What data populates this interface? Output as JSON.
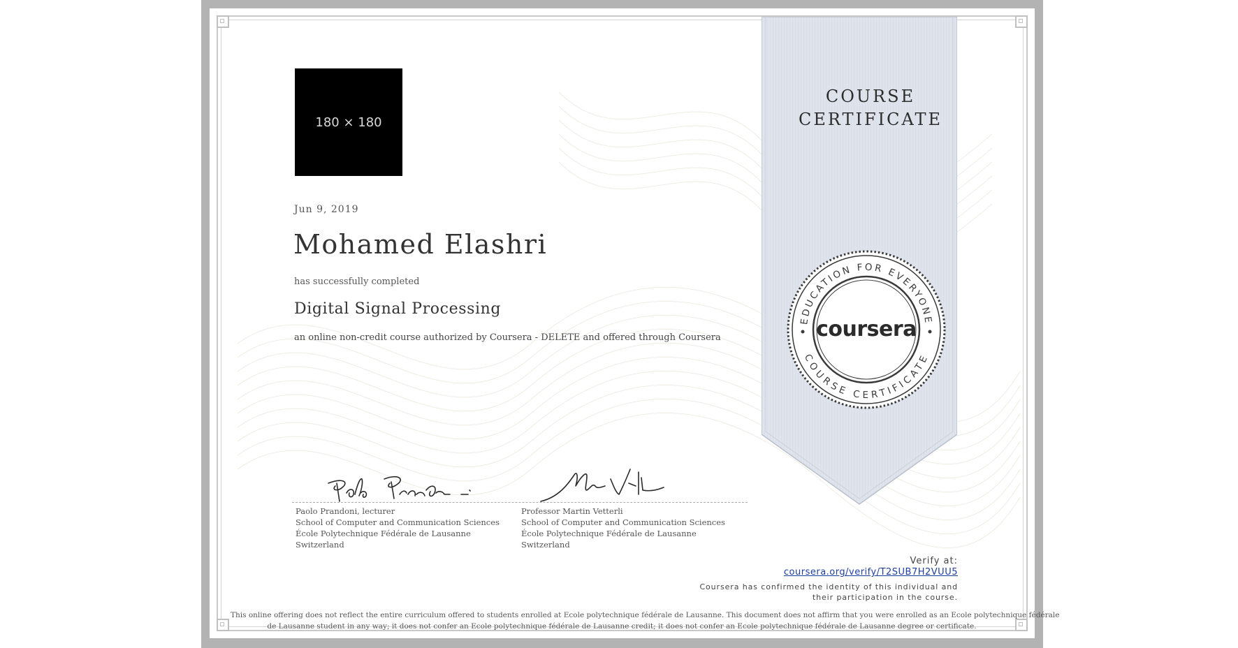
{
  "certificate": {
    "logo_placeholder": "180 × 180",
    "date": "Jun 9, 2019",
    "recipient_name": "Mohamed Elashri",
    "completed_text": "has successfully completed",
    "course_title": "Digital Signal Processing",
    "authorization_text": "an online non-credit course authorized by Coursera - DELETE and offered through Coursera"
  },
  "ribbon": {
    "title_line1": "COURSE",
    "title_line2": "CERTIFICATE"
  },
  "seal": {
    "logo": "coursera",
    "ring_top": "EDUCATION FOR EVERYONE",
    "ring_bottom": "COURSE CERTIFICATE"
  },
  "signers": [
    {
      "name": "Paolo Prandoni, lecturer",
      "department": "School of Computer and Communication Sciences",
      "institution": "École Polytechnique Fédérale de Lausanne",
      "country": "Switzerland",
      "signature_text": "Paolo Prandoni"
    },
    {
      "name": "Professor Martin Vetterli",
      "department": "School of Computer and Communication Sciences",
      "institution": "École Polytechnique Fédérale de Lausanne",
      "country": "Switzerland",
      "signature_text": "Martin Vetterli"
    }
  ],
  "verify": {
    "label": "Verify at:",
    "link": "coursera.org/verify/T2SUB7H2VUU5",
    "note_line1": "Coursera has confirmed the identity of this individual and",
    "note_line2": "their participation in the course."
  },
  "disclaimer": {
    "line1": "This online offering does not reflect the entire curriculum offered to students enrolled at Ecole polytechnique fédérale de Lausanne. This document does not affirm that you were enrolled as an Ecole polytechnique fédérale",
    "line2": "de Lausanne student in any way; it does not confer an Ecole polytechnique fédérale de Lausanne credit; it does not confer an Ecole polytechnique fédérale de Lausanne degree or certificate."
  },
  "colors": {
    "frame": "#b3b3b3",
    "ribbon": "#dfe4ec",
    "ribbon_edge": "#b9c0cc",
    "link": "#1f3f9e",
    "seal_ring": "#3a3a3a"
  }
}
